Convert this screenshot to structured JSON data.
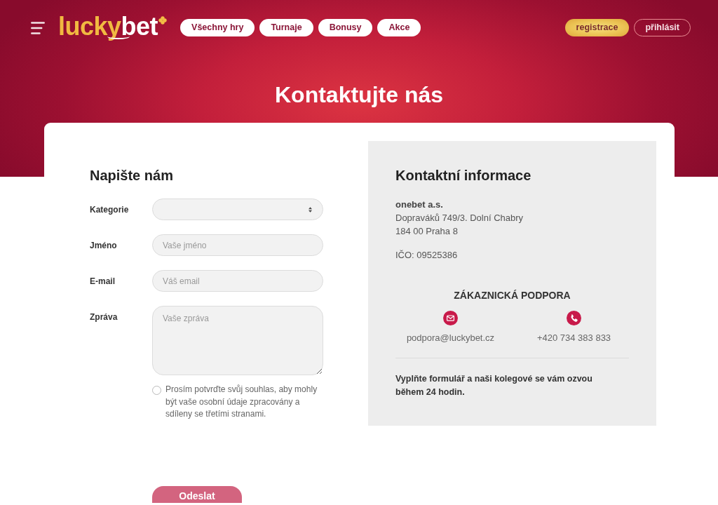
{
  "header": {
    "logo": {
      "first_part": "lucky",
      "second_part": "bet"
    },
    "nav": [
      {
        "label": "Všechny hry"
      },
      {
        "label": "Turnaje"
      },
      {
        "label": "Bonusy"
      },
      {
        "label": "Akce"
      }
    ],
    "actions": [
      {
        "label": "registrace",
        "kind": "primary"
      },
      {
        "label": "přihlásit",
        "kind": "outline"
      }
    ]
  },
  "page_title": "Kontaktujte nás",
  "form": {
    "title": "Napište nám",
    "fields": [
      {
        "label": "Kategorie",
        "kind": "select"
      },
      {
        "label": "Jméno",
        "kind": "text",
        "placeholder": "Vaše jméno"
      },
      {
        "label": "E-mail",
        "kind": "email",
        "placeholder": "Váš email"
      },
      {
        "label": "Zpráva",
        "kind": "textarea",
        "placeholder": "Vaše zpráva"
      }
    ],
    "consent": {
      "text": "Prosím potvrďte svůj souhlas, aby mohly být vaše osobní údaje zpracovány a sdíleny se třetími stranami.",
      "checked": false
    },
    "submit": {
      "label": "Odeslat",
      "disabled": true
    }
  },
  "contact": {
    "title": "Kontaktní informace",
    "company": "onebet a.s.",
    "address": [
      "Dopraváků 749/3. Dolní Chabry",
      "184 00 Praha 8"
    ],
    "company_id": "IČO: 09525386",
    "support": {
      "title": "ZÁKAZNICKÁ PODPORA",
      "channels": [
        {
          "kind": "email",
          "text": "podpora@luckybet.cz"
        },
        {
          "kind": "phone",
          "text": "+420 734 383 833"
        }
      ]
    },
    "note": "Vyplňte formulář a naši kolegové se vám ozvou během 24 hodin."
  }
}
